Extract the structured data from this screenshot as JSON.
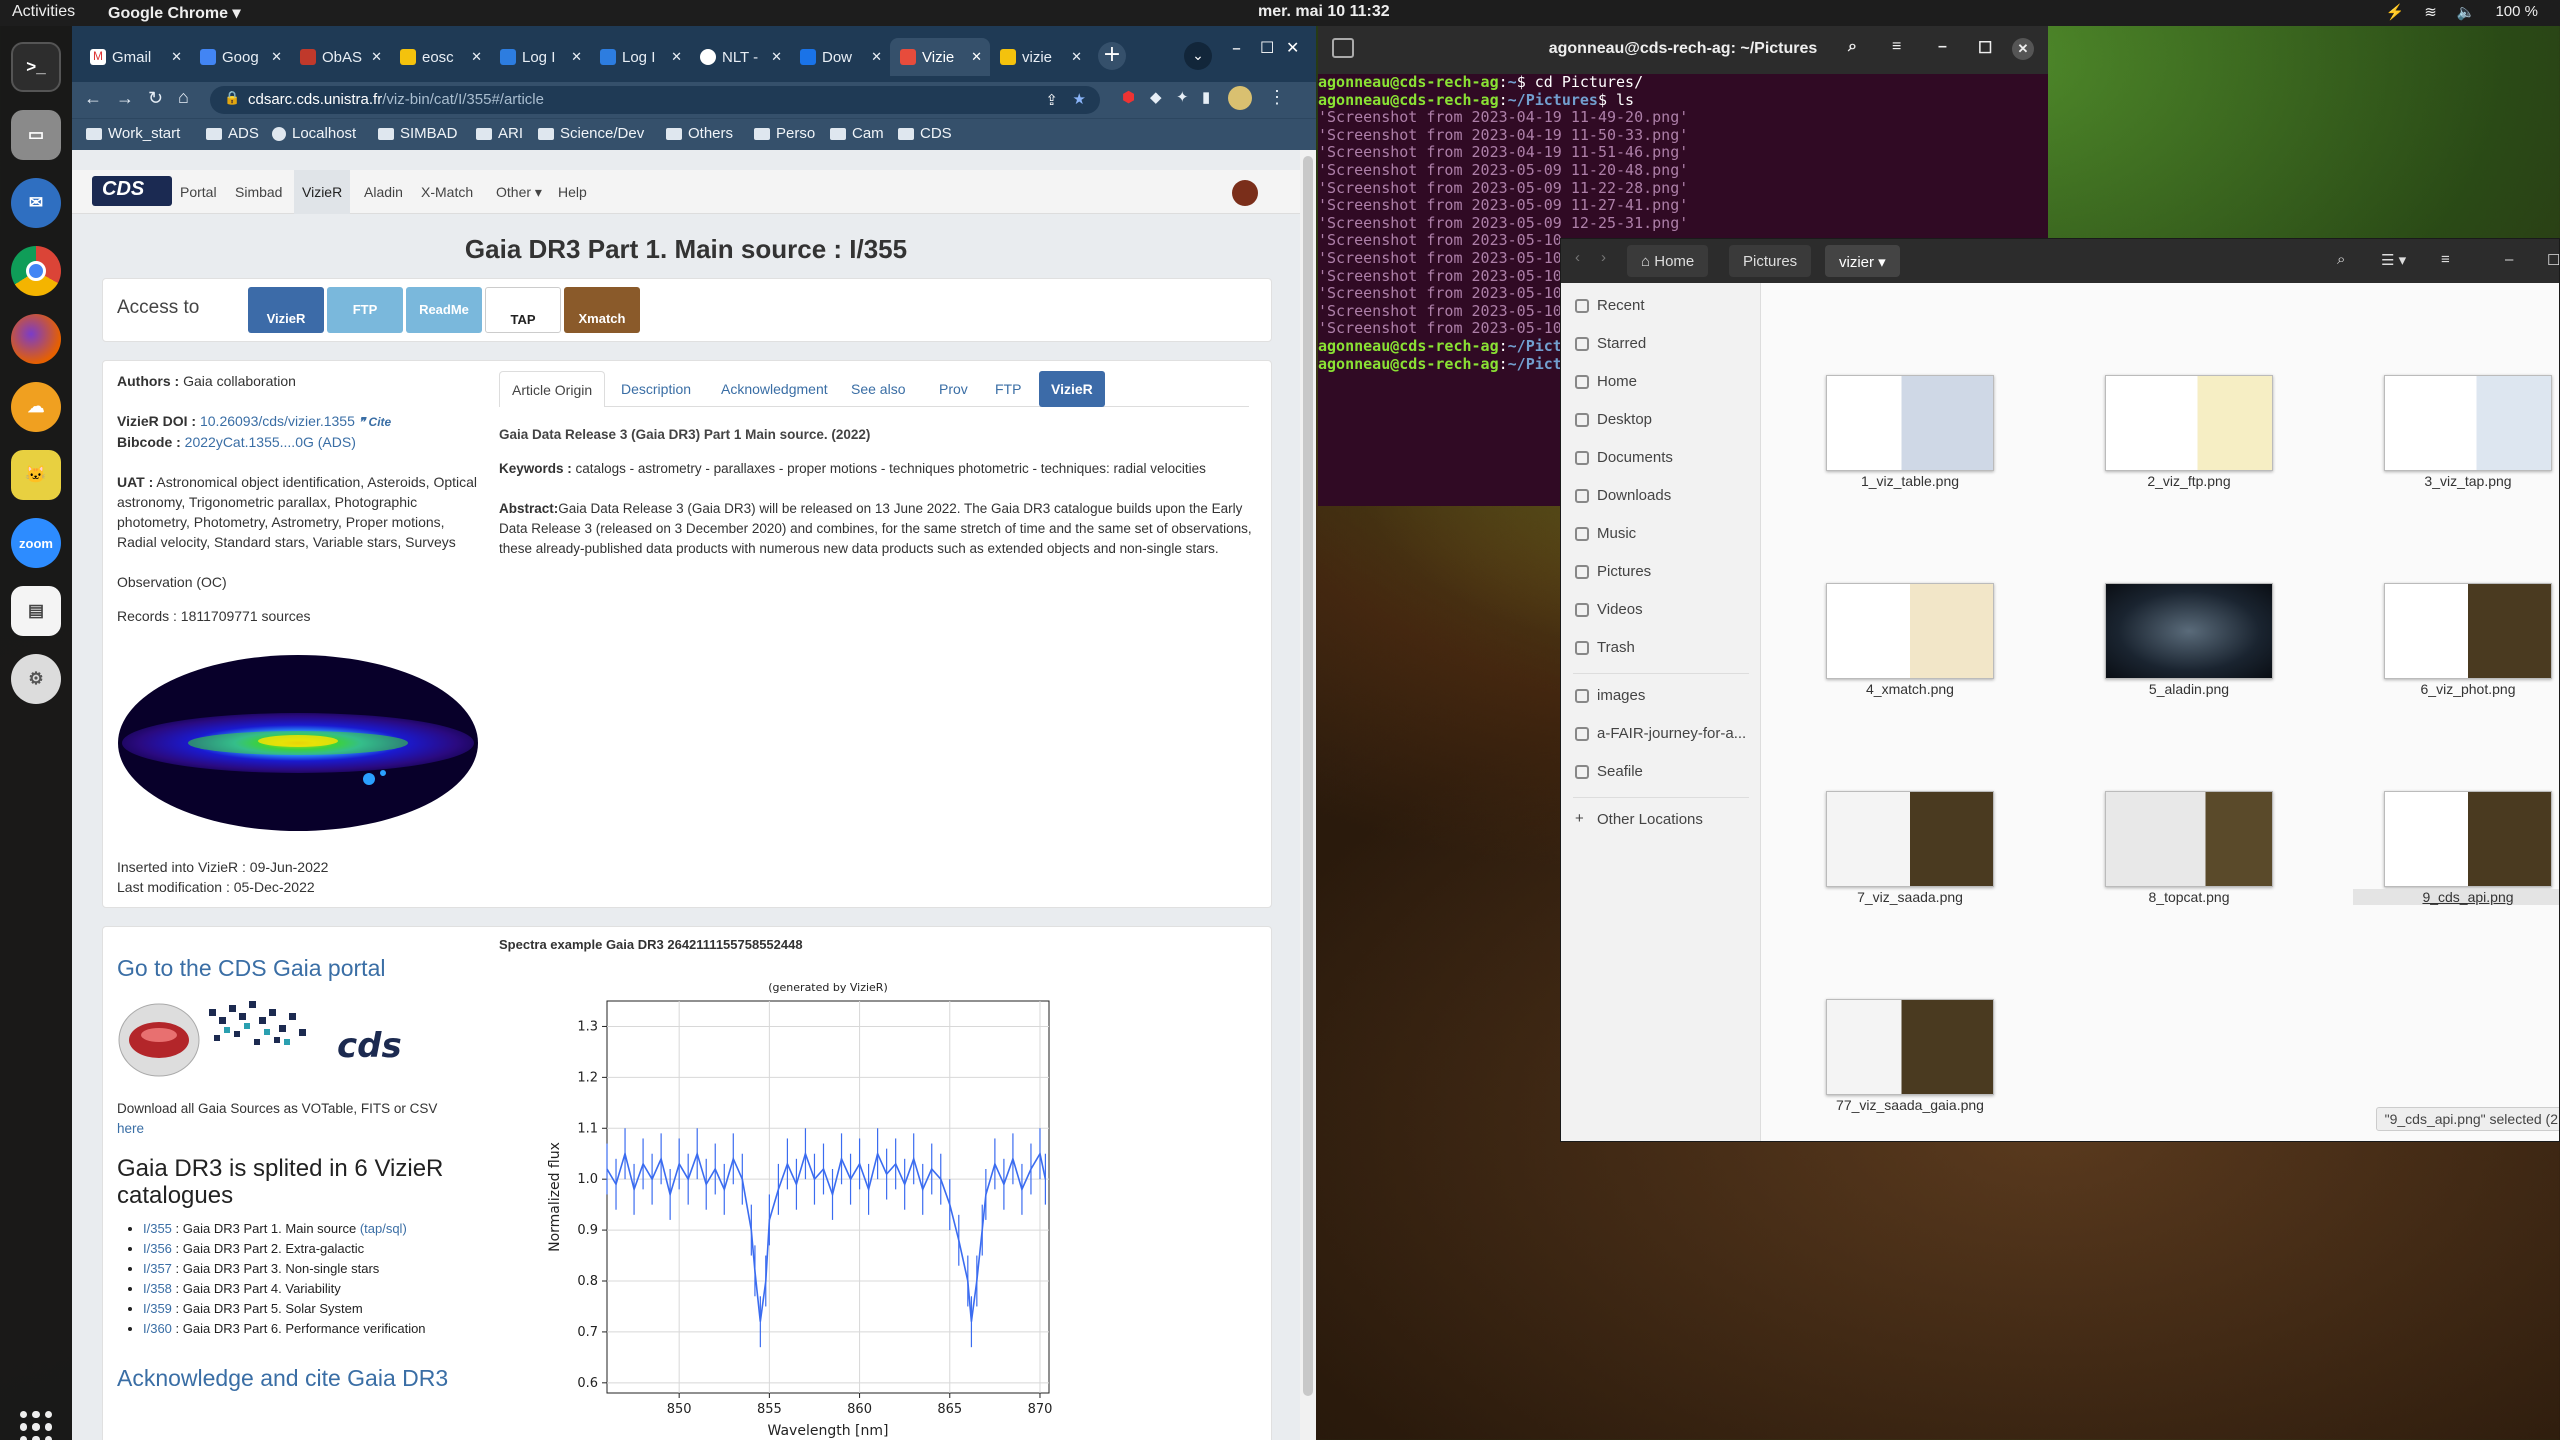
{
  "topbar": {
    "activities": "Activities",
    "app": "Google Chrome ▾",
    "clock": "mer. mai 10  11:32",
    "battery": "100 %",
    "tray": [
      "⚡",
      "📶",
      "🔊",
      "🔋"
    ]
  },
  "dock": [
    {
      "name": "terminal-icon",
      "label": ">_"
    },
    {
      "name": "files-icon",
      "label": ""
    },
    {
      "name": "thunderbird-icon",
      "label": ""
    },
    {
      "name": "chrome-icon",
      "label": ""
    },
    {
      "name": "firefox-icon",
      "label": ""
    },
    {
      "name": "owncloud-icon",
      "label": ""
    },
    {
      "name": "topcat-icon",
      "label": ""
    },
    {
      "name": "zoom-icon",
      "label": "zoom"
    },
    {
      "name": "document-viewer-icon",
      "label": ""
    },
    {
      "name": "settings-icon",
      "label": ""
    }
  ],
  "chrome": {
    "tabs": [
      "Gmail",
      "Goog",
      "ObAS",
      "eosc",
      "Log I",
      "Log I",
      "NLT -",
      "Dow",
      "Vizie",
      "vizie"
    ],
    "url_host": "cdsarc.cds.unistra.fr",
    "url_path": "/viz-bin/cat/I/355#/article",
    "bookmarks": [
      "Work_start",
      "ADS",
      "Localhost",
      "SIMBAD",
      "ARI",
      "Science/Dev",
      "Others",
      "Perso",
      "Cam",
      "CDS"
    ]
  },
  "site": {
    "logo": "CDS",
    "nav": [
      "Portal",
      "Simbad",
      "VizieR",
      "Aladin",
      "X-Match",
      "Other ▾",
      "Help"
    ],
    "title": "Gaia DR3 Part 1. Main source : I/355",
    "access_label": "Access to",
    "access_buttons": [
      "VizieR",
      "FTP",
      "ReadMe",
      "TAP",
      "Xmatch"
    ],
    "authors_label": "Authors :",
    "authors": "Gaia collaboration",
    "doi_label": "VizieR DOI :",
    "doi": "10.26093/cds/vizier.1355",
    "cite": "❞ Cite",
    "bibcode_label": "Bibcode :",
    "bibcode": "2022yCat.1355....0G (ADS)",
    "uat_label": "UAT :",
    "uat": "Astronomical object identification, Asteroids, Optical astronomy, Trigonometric parallax, Photographic photometry, Photometry, Astrometry, Proper motions, Radial velocity, Standard stars, Variable stars, Surveys",
    "observation": "Observation (OC)",
    "records": "Records : 1811709771 sources",
    "inserted": "Inserted into VizieR : 09-Jun-2022",
    "modified": "Last modification : 05-Dec-2022",
    "tabs": [
      "Article Origin",
      "Description",
      "Acknowledgment",
      "See also",
      "Prov",
      "FTP",
      "VizieR"
    ],
    "article_title": "Gaia Data Release 3 (Gaia DR3) Part 1 Main source. (2022)",
    "keywords_label": "Keywords :",
    "keywords": "catalogs - astrometry - parallaxes - proper motions - techniques photometric - techniques: radial velocities",
    "abstract_label": "Abstract:",
    "abstract": "Gaia Data Release 3 (Gaia DR3) will be released on 13 June 2022. The Gaia DR3 catalogue builds upon the Early Data Release 3 (released on 3 December 2020) and combines, for the same stretch of time and the same set of observations, these already-published data products with numerous new data products such as extended objects and non-single stars.",
    "portal_heading": "Go to the CDS Gaia portal",
    "download_text": "Download all Gaia Sources as VOTable, FITS or CSV",
    "download_link": "here",
    "split_heading": "Gaia DR3 is splited in 6 VizieR catalogues",
    "catalogues": [
      {
        "id": "I/355",
        "desc": ": Gaia DR3 Part 1. Main source",
        "extra": "(tap/sql)"
      },
      {
        "id": "I/356",
        "desc": ": Gaia DR3 Part 2. Extra-galactic",
        "extra": ""
      },
      {
        "id": "I/357",
        "desc": ": Gaia DR3 Part 3. Non-single stars",
        "extra": ""
      },
      {
        "id": "I/358",
        "desc": ": Gaia DR3 Part 4. Variability",
        "extra": ""
      },
      {
        "id": "I/359",
        "desc": ": Gaia DR3 Part 5. Solar System",
        "extra": ""
      },
      {
        "id": "I/360",
        "desc": ": Gaia DR3 Part 6. Performance verification",
        "extra": ""
      }
    ],
    "ack_heading": "Acknowledge and cite Gaia DR3",
    "spectra_title": "Spectra example Gaia DR3 2642111155758552448"
  },
  "chart_data": {
    "type": "line",
    "title": "(generated by VizieR)",
    "xlabel": "Wavelength [nm]",
    "ylabel": "Normalized flux",
    "xlim": [
      846,
      870.5
    ],
    "ylim": [
      0.58,
      1.35
    ],
    "xticks": [
      850,
      855,
      860,
      865,
      870
    ],
    "yticks": [
      0.6,
      0.7,
      0.8,
      0.9,
      1.0,
      1.1,
      1.2,
      1.3
    ],
    "color": "#3b6cf0",
    "series": [
      {
        "x": [
          846.0,
          846.5,
          847.0,
          847.5,
          848.0,
          848.5,
          849.0,
          849.5,
          850.0,
          850.5,
          851.0,
          851.5,
          852.0,
          852.5,
          853.0,
          853.5,
          854.0,
          854.2,
          854.5,
          854.8,
          855.0,
          855.5,
          856.0,
          856.5,
          857.0,
          857.5,
          858.0,
          858.5,
          859.0,
          859.5,
          860.0,
          860.5,
          861.0,
          861.5,
          862.0,
          862.5,
          863.0,
          863.5,
          864.0,
          864.5,
          865.0,
          865.5,
          866.0,
          866.2,
          866.5,
          866.8,
          867.0,
          867.5,
          868.0,
          868.5,
          869.0,
          869.5,
          870.0,
          870.3
        ],
        "y": [
          1.02,
          0.99,
          1.05,
          0.98,
          1.03,
          1.0,
          1.04,
          0.97,
          1.03,
          1.0,
          1.05,
          0.99,
          1.02,
          0.98,
          1.04,
          1.0,
          0.9,
          0.82,
          0.72,
          0.8,
          0.92,
          0.98,
          1.03,
          0.99,
          1.05,
          1.0,
          1.02,
          0.97,
          1.04,
          1.0,
          1.03,
          0.98,
          1.05,
          1.01,
          1.03,
          0.99,
          1.04,
          0.98,
          1.02,
          1.0,
          0.95,
          0.88,
          0.8,
          0.72,
          0.8,
          0.9,
          0.97,
          1.03,
          0.99,
          1.04,
          0.98,
          1.02,
          1.05,
          1.0
        ]
      }
    ]
  },
  "terminal": {
    "title": "agonneau@cds-rech-ag: ~/Pictures",
    "user": "agonneau@cds-rech-ag",
    "path1": "~",
    "cmd1": "cd Pictures/",
    "path2": "~/Pictures",
    "cmd2": "ls",
    "lines": [
      "'Screenshot from 2023-04-19 11-49-20.png'",
      "'Screenshot from 2023-04-19 11-50-33.png'",
      "'Screenshot from 2023-04-19 11-51-46.png'",
      "'Screenshot from 2023-05-09 11-20-48.png'",
      "'Screenshot from 2023-05-09 11-22-28.png'",
      "'Screenshot from 2023-05-09 11-27-41.png'",
      "'Screenshot from 2023-05-09 12-25-31.png'",
      "'Screenshot from 2023-05-10",
      "'Screenshot from 2023-05-10",
      "'Screenshot from 2023-05-10",
      "'Screenshot from 2023-05-10",
      "'Screenshot from 2023-05-10",
      "'Screenshot from 2023-05-10"
    ],
    "prompt_tail1": "~/Pict",
    "prompt_tail2": "~/Pict"
  },
  "files": {
    "crumbs": [
      "Home",
      "Pictures",
      "vizier"
    ],
    "sidebar": [
      "Recent",
      "Starred",
      "Home",
      "Desktop",
      "Documents",
      "Downloads",
      "Music",
      "Pictures",
      "Videos",
      "Trash",
      "images",
      "a-FAIR-journey-for-a...",
      "Seafile",
      "Other Locations"
    ],
    "items": [
      "1_viz_table.png",
      "2_viz_ftp.png",
      "3_viz_tap.png",
      "4_xmatch.png",
      "5_aladin.png",
      "6_viz_phot.png",
      "7_viz_saada.png",
      "8_topcat.png",
      "9_cds_api.png",
      "77_viz_saada_gaia.png"
    ],
    "status": "\"9_cds_api.png\" selected  (2"
  }
}
